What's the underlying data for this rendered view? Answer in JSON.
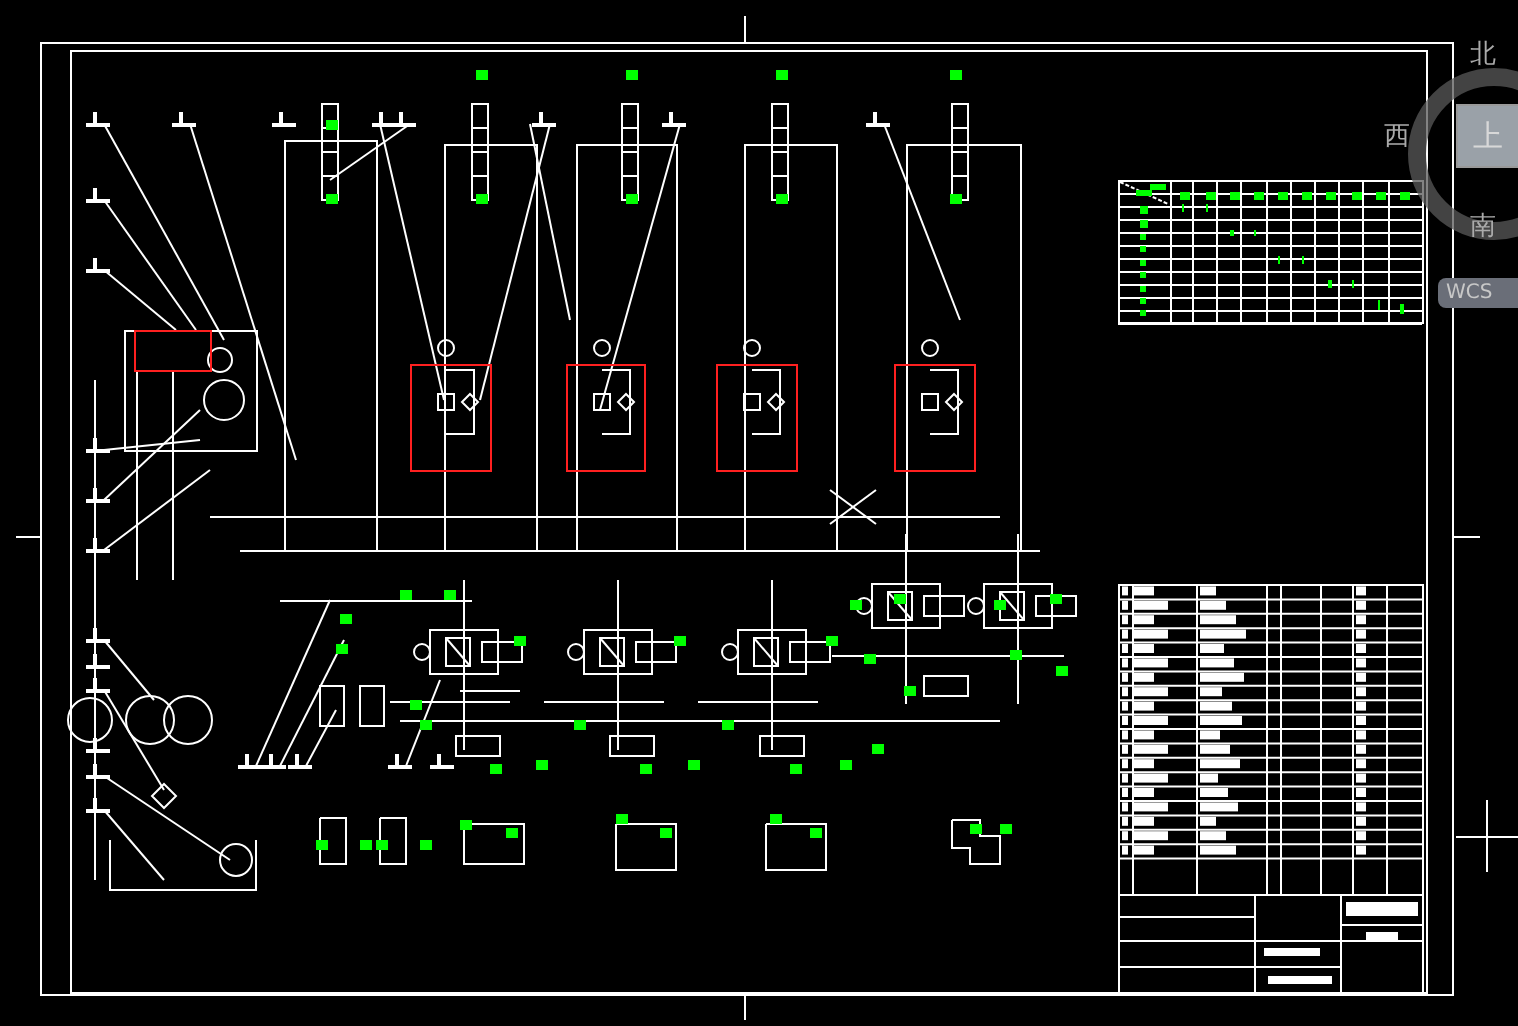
{
  "view_cube": {
    "directions": [
      {
        "kind": "north",
        "label": "北"
      },
      {
        "kind": "west",
        "label": "西"
      },
      {
        "kind": "south",
        "label": "南"
      }
    ],
    "top_face": "上",
    "coordinate_system": "WCS"
  }
}
